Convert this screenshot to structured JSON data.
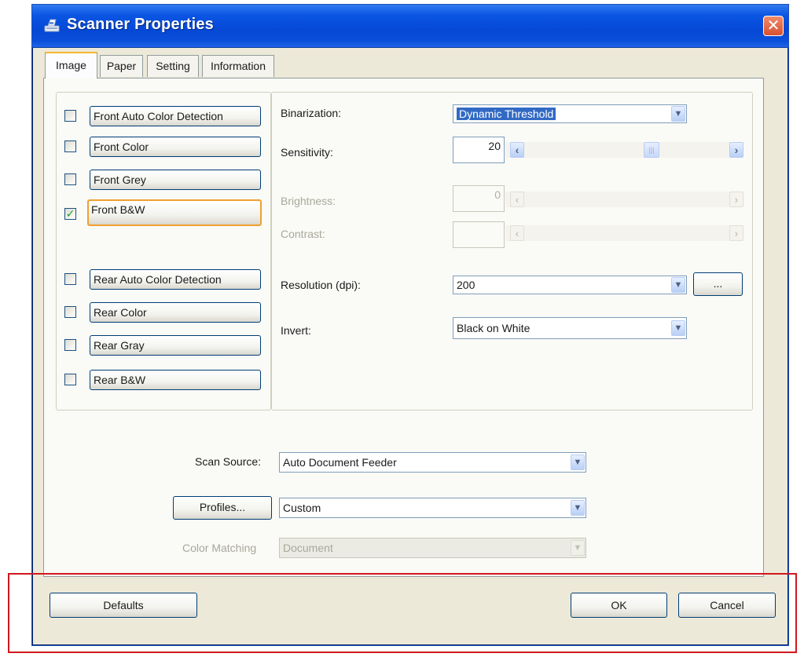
{
  "window": {
    "title": "Scanner Properties",
    "close_glyph": "✕"
  },
  "tabs": [
    {
      "label": "Image",
      "active": true
    },
    {
      "label": "Paper",
      "active": false
    },
    {
      "label": "Setting",
      "active": false
    },
    {
      "label": "Information",
      "active": false
    }
  ],
  "image_types": [
    {
      "label": "Front Auto Color Detection",
      "checked": false
    },
    {
      "label": "Front Color",
      "checked": false
    },
    {
      "label": "Front Grey",
      "checked": false
    },
    {
      "label": "Front B&W",
      "checked": true
    },
    {
      "label": "Rear Auto Color Detection",
      "checked": false
    },
    {
      "label": "Rear Color",
      "checked": false
    },
    {
      "label": "Rear Gray",
      "checked": false
    },
    {
      "label": "Rear B&W",
      "checked": false
    }
  ],
  "binarization": {
    "label": "Binarization:",
    "value": "Dynamic Threshold"
  },
  "sensitivity": {
    "label": "Sensitivity:",
    "value": "20"
  },
  "brightness": {
    "label": "Brightness:",
    "value": "0"
  },
  "contrast": {
    "label": "Contrast:",
    "value": ""
  },
  "resolution": {
    "label": "Resolution (dpi):",
    "value": "200",
    "more_button": "..."
  },
  "invert": {
    "label": "Invert:",
    "value": "Black on White"
  },
  "scan_source": {
    "label": "Scan Source:",
    "value": "Auto Document Feeder"
  },
  "profiles": {
    "button_label": "Profiles...",
    "value": "Custom"
  },
  "color_matching": {
    "label": "Color Matching",
    "value": "Document"
  },
  "footer": {
    "defaults_label": "Defaults",
    "ok_label": "OK",
    "cancel_label": "Cancel"
  },
  "icons": {
    "dropdown_arrow": "chevron-down-icon",
    "scroll_left": "‹",
    "scroll_right": "›",
    "check_mark": "✓",
    "thumb_grip": "|||"
  },
  "colors": {
    "titlebar": "#0548d6",
    "close": "#d8512e",
    "selection": "#316ac5",
    "focus": "#f0a030",
    "annotation": "#d0181e",
    "face": "#ece9d8"
  }
}
